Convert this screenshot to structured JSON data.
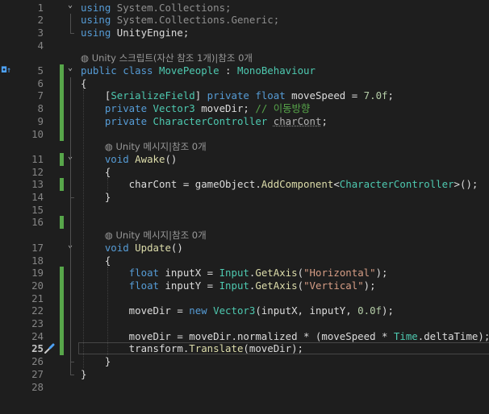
{
  "editor": {
    "current_line": 25,
    "lines": [
      {
        "n": 1,
        "change": false,
        "fold": "minus",
        "segs": [
          [
            "kw",
            "using "
          ],
          [
            "dim",
            "System.Collections;"
          ]
        ]
      },
      {
        "n": 2,
        "change": false,
        "fold": "",
        "segs": [
          [
            "kw",
            "using "
          ],
          [
            "dim",
            "System.Collections.Generic;"
          ]
        ]
      },
      {
        "n": 3,
        "change": false,
        "fold": "",
        "segs": [
          [
            "kw",
            "using "
          ],
          [
            "pl",
            "UnityEngine;"
          ]
        ]
      },
      {
        "n": 4,
        "change": false,
        "fold": "",
        "segs": []
      },
      {
        "n": null,
        "hint": "Unity 스크립트(자산 참조 1개)|참조 0개",
        "indent": 0
      },
      {
        "n": 5,
        "change": true,
        "fold": "minus",
        "glyph": "◘↑",
        "segs": [
          [
            "kw",
            "public "
          ],
          [
            "kw",
            "class "
          ],
          [
            "ty",
            "MovePeople"
          ],
          [
            "pl",
            " : "
          ],
          [
            "ty",
            "MonoBehaviour"
          ]
        ]
      },
      {
        "n": 6,
        "change": true,
        "fold": "",
        "segs": [
          [
            "pl",
            "{"
          ]
        ]
      },
      {
        "n": 7,
        "change": true,
        "fold": "",
        "segs": [
          [
            "pl",
            "    ["
          ],
          [
            "ty",
            "SerializeField"
          ],
          [
            "pl",
            "] "
          ],
          [
            "kw",
            "private "
          ],
          [
            "kw",
            "float "
          ],
          [
            "pl",
            "moveSpeed = "
          ],
          [
            "num",
            "7.0f"
          ],
          [
            "pl",
            ";"
          ]
        ]
      },
      {
        "n": 8,
        "change": true,
        "fold": "",
        "segs": [
          [
            "pl",
            "    "
          ],
          [
            "kw",
            "private "
          ],
          [
            "ty",
            "Vector3"
          ],
          [
            "pl",
            " moveDir; "
          ],
          [
            "cm",
            "// 이동방향"
          ]
        ]
      },
      {
        "n": 9,
        "change": true,
        "fold": "",
        "segs": [
          [
            "pl",
            "    "
          ],
          [
            "kw",
            "private "
          ],
          [
            "ty",
            "CharacterController"
          ],
          [
            "pl",
            " "
          ],
          [
            "unused",
            "charCont"
          ],
          [
            "pl",
            ";"
          ]
        ]
      },
      {
        "n": 10,
        "change": true,
        "fold": "",
        "segs": []
      },
      {
        "n": null,
        "hint": "Unity 메시지|참조 0개",
        "indent": 4
      },
      {
        "n": 11,
        "change": true,
        "fold": "minus",
        "segs": [
          [
            "pl",
            "    "
          ],
          [
            "kw",
            "void "
          ],
          [
            "fn",
            "Awake"
          ],
          [
            "pl",
            "()"
          ]
        ]
      },
      {
        "n": 12,
        "change": false,
        "fold": "",
        "segs": [
          [
            "pl",
            "    {"
          ]
        ]
      },
      {
        "n": 13,
        "change": true,
        "fold": "",
        "segs": [
          [
            "pl",
            "        charCont = gameObject."
          ],
          [
            "fn",
            "AddComponent"
          ],
          [
            "pl",
            "<"
          ],
          [
            "ty",
            "CharacterController"
          ],
          [
            "pl",
            ">();"
          ]
        ]
      },
      {
        "n": 14,
        "change": false,
        "fold": "",
        "segs": [
          [
            "pl",
            "    }"
          ]
        ]
      },
      {
        "n": 15,
        "change": false,
        "fold": "",
        "segs": []
      },
      {
        "n": 16,
        "change": true,
        "fold": "",
        "segs": []
      },
      {
        "n": null,
        "hint": "Unity 메시지|참조 0개",
        "indent": 4
      },
      {
        "n": 17,
        "change": false,
        "fold": "minus",
        "segs": [
          [
            "pl",
            "    "
          ],
          [
            "kw",
            "void "
          ],
          [
            "fn",
            "Update"
          ],
          [
            "pl",
            "()"
          ]
        ]
      },
      {
        "n": 18,
        "change": false,
        "fold": "",
        "segs": [
          [
            "pl",
            "    {"
          ]
        ]
      },
      {
        "n": 19,
        "change": true,
        "fold": "",
        "segs": [
          [
            "pl",
            "        "
          ],
          [
            "kw",
            "float "
          ],
          [
            "pl",
            "inputX = "
          ],
          [
            "ty",
            "Input"
          ],
          [
            "pl",
            "."
          ],
          [
            "fn",
            "GetAxis"
          ],
          [
            "pl",
            "("
          ],
          [
            "str",
            "\"Horizontal\""
          ],
          [
            "pl",
            ");"
          ]
        ]
      },
      {
        "n": 20,
        "change": true,
        "fold": "",
        "segs": [
          [
            "pl",
            "        "
          ],
          [
            "kw",
            "float "
          ],
          [
            "pl",
            "inputY = "
          ],
          [
            "ty",
            "Input"
          ],
          [
            "pl",
            "."
          ],
          [
            "fn",
            "GetAxis"
          ],
          [
            "pl",
            "("
          ],
          [
            "str",
            "\"Vertical\""
          ],
          [
            "pl",
            ");"
          ]
        ]
      },
      {
        "n": 21,
        "change": true,
        "fold": "",
        "segs": []
      },
      {
        "n": 22,
        "change": true,
        "fold": "",
        "segs": [
          [
            "pl",
            "        moveDir = "
          ],
          [
            "kw",
            "new "
          ],
          [
            "ty",
            "Vector3"
          ],
          [
            "pl",
            "(inputX, inputY, "
          ],
          [
            "num",
            "0.0f"
          ],
          [
            "pl",
            ");"
          ]
        ]
      },
      {
        "n": 23,
        "change": true,
        "fold": "",
        "segs": []
      },
      {
        "n": 24,
        "change": true,
        "fold": "",
        "segs": [
          [
            "pl",
            "        moveDir = moveDir.normalized * (moveSpeed * "
          ],
          [
            "ty",
            "Time"
          ],
          [
            "pl",
            ".deltaTime);"
          ]
        ]
      },
      {
        "n": 25,
        "change": true,
        "fold": "",
        "screw": true,
        "segs": [
          [
            "pl",
            "        transform."
          ],
          [
            "fn",
            "Translate"
          ],
          [
            "pl",
            "(moveDir);"
          ]
        ]
      },
      {
        "n": 26,
        "change": false,
        "fold": "",
        "segs": [
          [
            "pl",
            "    }"
          ]
        ]
      },
      {
        "n": 27,
        "change": false,
        "fold": "",
        "segs": [
          [
            "pl",
            "}"
          ]
        ]
      },
      {
        "n": 28,
        "change": false,
        "fold": "",
        "segs": []
      }
    ]
  },
  "colors": {
    "background": "#1e1e1e",
    "keyword": "#569cd6",
    "type": "#4ec9b0",
    "method": "#dcdcaa",
    "string": "#d69d85",
    "number": "#b5cea8",
    "comment": "#57a64a",
    "change_bar": "#57a64a"
  },
  "icons": {
    "fold_minus": "collapse-chevron-icon",
    "quick_action": "screwdriver-icon",
    "codelens": "unity-logo-icon",
    "implementation": "implementation-arrow-icon"
  }
}
